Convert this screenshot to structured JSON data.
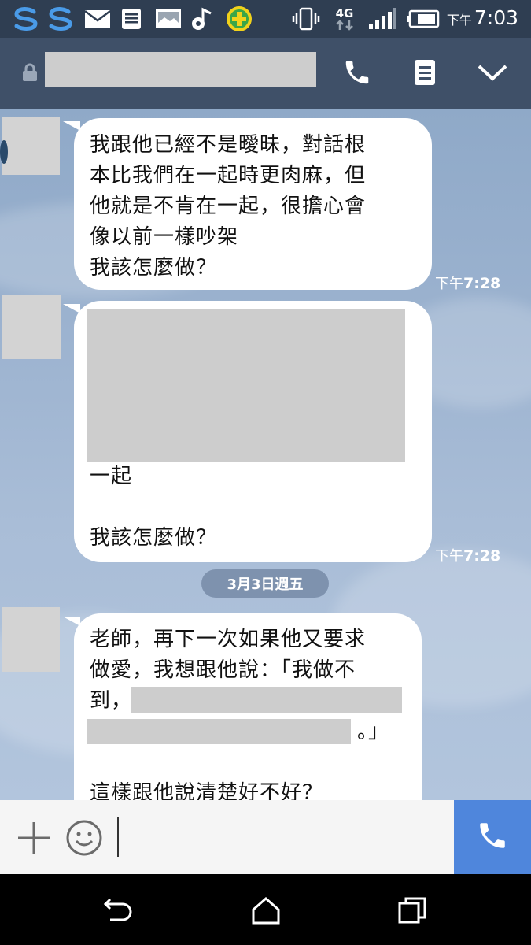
{
  "status_bar": {
    "ampm": "下午",
    "time": "7:03",
    "network": "4G",
    "icons": [
      "s-app-icon",
      "s-app-icon",
      "mail-icon",
      "document-icon",
      "image-icon",
      "music-icon",
      "plus-app-icon",
      "vibrate-icon",
      "network-4g-icon",
      "signal-icon",
      "battery-icon"
    ]
  },
  "header": {
    "icons": [
      "lock-icon",
      "phone-icon",
      "menu-icon",
      "chevron-down-icon"
    ]
  },
  "messages": [
    {
      "lines": [
        "我跟他已經不是曖昧，對話根",
        "本比我們在一起時更肉麻，但",
        "他就是不肯在一起，很擔心會",
        "像以前一樣吵架",
        "我該怎麼做？"
      ],
      "time_ampm": "下午",
      "time": "7:28"
    },
    {
      "lines": [
        "一起",
        "",
        "我該怎麼做？"
      ],
      "time_ampm": "下午",
      "time": "7:28"
    },
    {
      "lines": [
        "老師，再下一次如果他又要求",
        "做愛，我想跟他說：「我做不",
        "到，",
        "。」",
        "",
        "這樣跟他說清楚好不好？"
      ]
    }
  ],
  "date_separator": "3月3日週五",
  "input_bar": {
    "icons": [
      "plus-icon",
      "emoji-icon",
      "phone-icon"
    ]
  },
  "nav_bar": {
    "icons": [
      "back-icon",
      "home-icon",
      "recents-icon"
    ]
  }
}
